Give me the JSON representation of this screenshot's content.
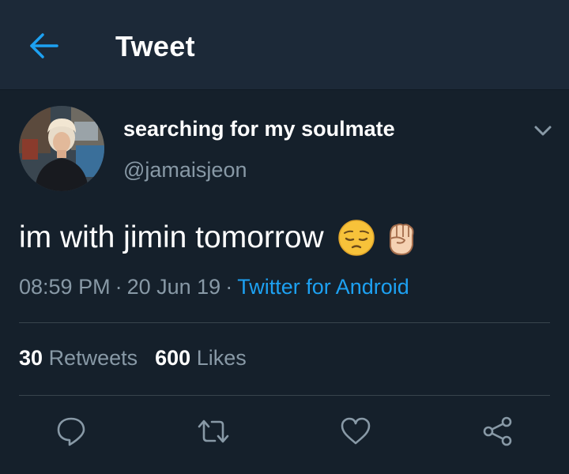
{
  "header": {
    "title": "Tweet",
    "back_icon": "arrow-left-icon",
    "accent_color": "#1da1f2",
    "background": "#1c2938"
  },
  "tweet": {
    "author": {
      "display_name": "searching for my soulmate",
      "handle": "@jamaisjeon",
      "avatar": "avatar-photo"
    },
    "text": "im with jimin tomorrow",
    "emojis": [
      "pensive-face",
      "raised-fist-light-skin-tone"
    ],
    "time": "08:59 PM",
    "date": "20 Jun 19",
    "separator": "·",
    "source": "Twitter for Android",
    "menu_icon": "chevron-down-icon"
  },
  "stats": {
    "retweets_count": "30",
    "retweets_label": "Retweets",
    "likes_count": "600",
    "likes_label": "Likes"
  },
  "actions": [
    "reply-icon",
    "retweet-icon",
    "like-icon",
    "share-icon"
  ],
  "colors": {
    "background": "#15202b",
    "secondary_text": "#8899a6",
    "divider": "#38444d",
    "link": "#1da1f2"
  }
}
